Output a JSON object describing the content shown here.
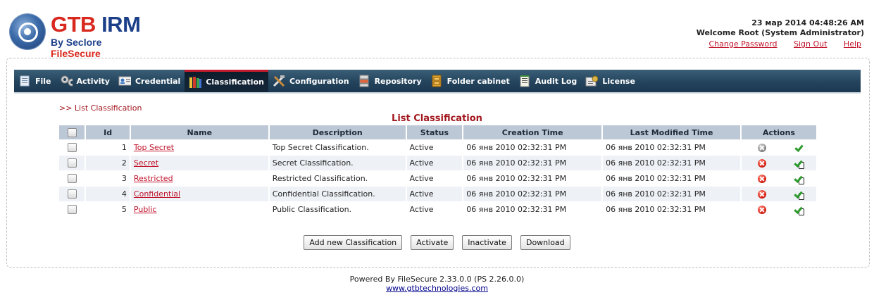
{
  "header": {
    "logo_title_main": "GTB IRM",
    "logo_subtitle": "By Seclore FileSecure",
    "datetime": "23 мар 2014 04:48:26 AM",
    "welcome": "Welcome Root (System Administrator)",
    "links": {
      "change_password": "Change Password",
      "sign_out": "Sign Out",
      "help": "Help"
    }
  },
  "nav": {
    "items": [
      {
        "label": "File",
        "icon": "file-icon"
      },
      {
        "label": "Activity",
        "icon": "gears-icon"
      },
      {
        "label": "Credential",
        "icon": "id-card-icon"
      },
      {
        "label": "Classification",
        "icon": "books-icon",
        "active": true
      },
      {
        "label": "Configuration",
        "icon": "tools-icon"
      },
      {
        "label": "Repository",
        "icon": "server-icon"
      },
      {
        "label": "Folder cabinet",
        "icon": "cabinet-icon"
      },
      {
        "label": "Audit Log",
        "icon": "notepad-icon"
      },
      {
        "label": "License",
        "icon": "certificate-icon"
      }
    ],
    "active_color": "#c01c2c"
  },
  "breadcrumb": ">> List Classification",
  "page_title": "List Classification",
  "table": {
    "columns": [
      "Id",
      "Name",
      "Description",
      "Status",
      "Creation Time",
      "Last Modified Time",
      "Actions"
    ],
    "rows": [
      {
        "id": "1",
        "name": "Top Secret",
        "description": "Top Secret Classification.",
        "status": "Active",
        "created": "06 янв 2010 02:32:31 PM",
        "modified": "06 янв 2010 02:32:31 PM",
        "delete_enabled": false
      },
      {
        "id": "2",
        "name": "Secret",
        "description": "Secret Classification.",
        "status": "Active",
        "created": "06 янв 2010 02:32:31 PM",
        "modified": "06 янв 2010 02:32:31 PM",
        "delete_enabled": true
      },
      {
        "id": "3",
        "name": "Restricted",
        "description": "Restricted Classification.",
        "status": "Active",
        "created": "06 янв 2010 02:32:31 PM",
        "modified": "06 янв 2010 02:32:31 PM",
        "delete_enabled": true
      },
      {
        "id": "4",
        "name": "Confidential",
        "description": "Confidential Classification.",
        "status": "Active",
        "created": "06 янв 2010 02:32:31 PM",
        "modified": "06 янв 2010 02:32:31 PM",
        "delete_enabled": true
      },
      {
        "id": "5",
        "name": "Public",
        "description": "Public Classification.",
        "status": "Active",
        "created": "06 янв 2010 02:32:31 PM",
        "modified": "06 янв 2010 02:32:31 PM",
        "delete_enabled": true
      }
    ]
  },
  "buttons": {
    "add": "Add new Classification",
    "activate": "Activate",
    "inactivate": "Inactivate",
    "download": "Download"
  },
  "footer": {
    "powered": "Powered By FileSecure 2.33.0.0 (PS 2.26.0.0)",
    "url": "www.gtbtechnologies.com"
  }
}
